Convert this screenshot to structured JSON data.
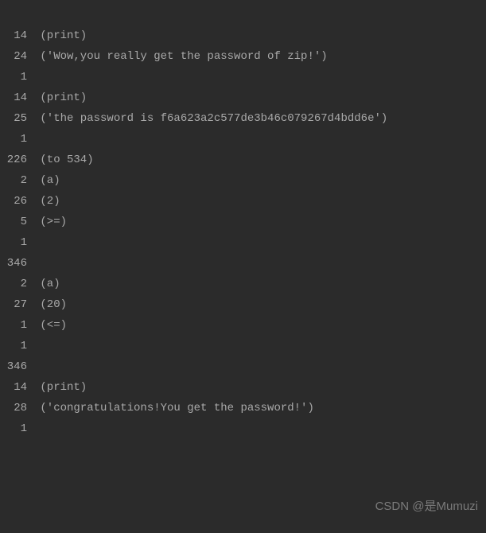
{
  "lines": [
    {
      "num": "14",
      "content": "(print)"
    },
    {
      "num": "24",
      "content": "('Wow,you really get the password of zip!')"
    },
    {
      "num": "1",
      "content": ""
    },
    {
      "num": "",
      "content": ""
    },
    {
      "num": "",
      "content": ""
    },
    {
      "num": "14",
      "content": "(print)"
    },
    {
      "num": "25",
      "content": "('the password is f6a623a2c577de3b46c079267d4bdd6e')"
    },
    {
      "num": "1",
      "content": ""
    },
    {
      "num": "",
      "content": ""
    },
    {
      "num": "226",
      "content": "(to 534)"
    },
    {
      "num": "",
      "content": ""
    },
    {
      "num": "2",
      "content": "(a)"
    },
    {
      "num": "26",
      "content": "(2)"
    },
    {
      "num": "5",
      "content": "(>=)"
    },
    {
      "num": "1",
      "content": ""
    },
    {
      "num": "346",
      "content": ""
    },
    {
      "num": "2",
      "content": "(a)"
    },
    {
      "num": "27",
      "content": "(20)"
    },
    {
      "num": "1",
      "content": "(<=)"
    },
    {
      "num": "1",
      "content": ""
    },
    {
      "num": "346",
      "content": ""
    },
    {
      "num": "",
      "content": ""
    },
    {
      "num": "14",
      "content": "(print)"
    },
    {
      "num": "28",
      "content": "('congratulations!You get the password!')"
    },
    {
      "num": "1",
      "content": ""
    }
  ],
  "watermark": "CSDN @是Mumuzi"
}
